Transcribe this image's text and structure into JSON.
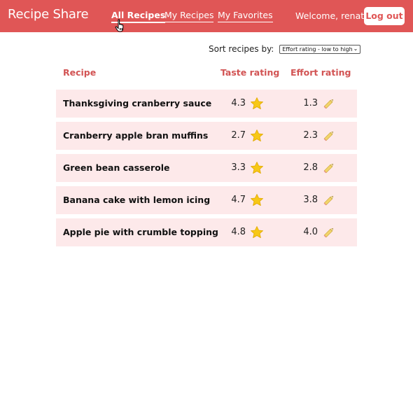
{
  "navbar": {
    "brand": "Recipe Share",
    "links": [
      {
        "label": "All Recipes",
        "active": true
      },
      {
        "label": "My Recipes",
        "active": false
      },
      {
        "label": "My Favorites",
        "active": false
      }
    ],
    "welcome": "Welcome, renata",
    "logout_label": "Log out",
    "accent_color": "#e05656"
  },
  "sort": {
    "label": "Sort recipes by:",
    "selected": "Effort rating - low to high"
  },
  "table": {
    "headers": {
      "recipe": "Recipe",
      "taste": "Taste rating",
      "effort": "Effort rating"
    },
    "taste_icon": "star-icon",
    "effort_icon": "pencil-icon",
    "rows": [
      {
        "name": "Thanksgiving cranberry sauce",
        "taste": "4.3",
        "effort": "1.3"
      },
      {
        "name": "Cranberry apple bran muffins",
        "taste": "2.7",
        "effort": "2.3"
      },
      {
        "name": "Green bean casserole",
        "taste": "3.3",
        "effort": "2.8"
      },
      {
        "name": "Banana cake with lemon icing",
        "taste": "4.7",
        "effort": "3.8"
      },
      {
        "name": "Apple pie with crumble topping",
        "taste": "4.8",
        "effort": "4.0"
      }
    ]
  }
}
